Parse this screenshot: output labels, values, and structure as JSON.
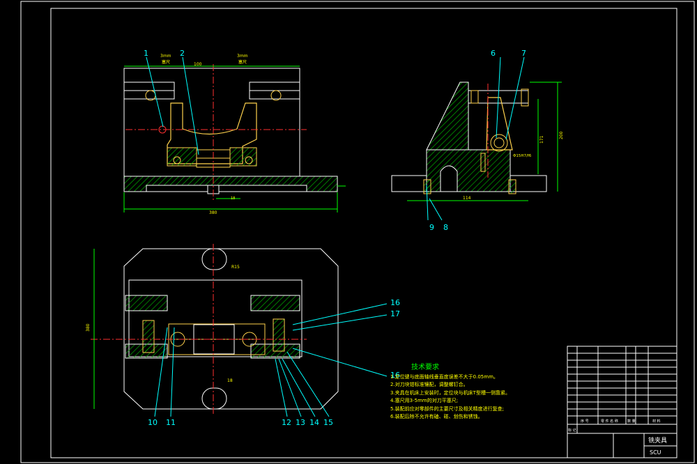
{
  "drawing": {
    "title_block": {
      "part_name": "铣夹具",
      "school": "SCU",
      "row_sign": "标 记",
      "row_label_left": "序 号",
      "row_label_mid": "零 件 名 称",
      "row_label_right": "材 料",
      "row_label_qty": "数 量"
    },
    "tech_notes": {
      "heading": "技术要求",
      "items": [
        "1.定位键与底面轴线垂直度误差不大于0.05mm。",
        "2.对刀块钳标准镶配，调整螺钉合。",
        "3.夹具在机床上安装时，定位块与机床T型槽一侧靠紧。",
        "4.塞尺用3-5mm的对刀平塞尺;",
        "5.装配前应对零部件的主要尺寸及相关精度进行复查;",
        "6.装配后除不允许有磕、碰、划伤和锈蚀。"
      ]
    },
    "callouts_front": [
      "1",
      "2"
    ],
    "callouts_side": [
      "6",
      "7",
      "9",
      "8"
    ],
    "callouts_plan_right": [
      "16",
      "17",
      "16"
    ],
    "callouts_plan_bottom": [
      "10",
      "11",
      "12",
      "13",
      "14",
      "15"
    ],
    "dims": {
      "front_width": "380",
      "front_top": "100",
      "front_small": "18",
      "gauge_left": "3mm\n塞尺",
      "gauge_right": "3mm\n塞尺",
      "side_height1": "171",
      "side_height2": "200",
      "side_base": "114",
      "side_fit": "Φ15H7/f6",
      "plan_height": "380",
      "plan_slot_top": "R15",
      "plan_slot_bot": "18"
    },
    "colors": {
      "outline": "#ffffff",
      "part": "#ffd24d",
      "hatch": "#00b000",
      "leader": "#00ffff",
      "text": "#ffff00",
      "center": "#ff3030"
    }
  }
}
